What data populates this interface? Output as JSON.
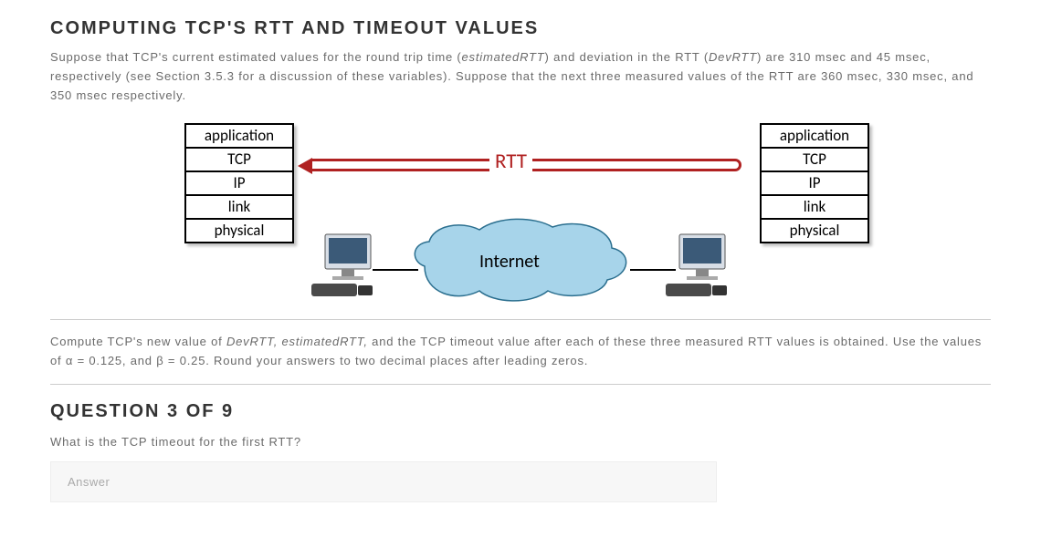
{
  "title": "COMPUTING TCP'S RTT AND TIMEOUT VALUES",
  "intro_p1_a": "Suppose that TCP's current estimated values for the round trip time (",
  "intro_p1_b": "estimatedRTT",
  "intro_p1_c": ") and deviation in the RTT (",
  "intro_p1_d": "DevRTT",
  "intro_p1_e": ") are 310 msec and 45 msec, respectively (see Section 3.5.3 for a discussion of these variables). Suppose that the next three measured values of the RTT are 360 msec, 330 msec, and 350 msec respectively.",
  "diagram": {
    "layers": [
      "application",
      "TCP",
      "IP",
      "link",
      "physical"
    ],
    "rtt_label": "RTT",
    "cloud_label": "Internet"
  },
  "intro_p2_a": "Compute TCP's new value of ",
  "intro_p2_b": "DevRTT, estimatedRTT,",
  "intro_p2_c": " and the TCP timeout value after each of these three measured RTT values is obtained. Use the values of α = 0.125, and β = 0.25. Round your answers to two decimal places after leading zeros.",
  "question": {
    "heading": "QUESTION 3 OF 9",
    "text": "What is the TCP timeout for the first RTT?",
    "placeholder": "Answer"
  }
}
